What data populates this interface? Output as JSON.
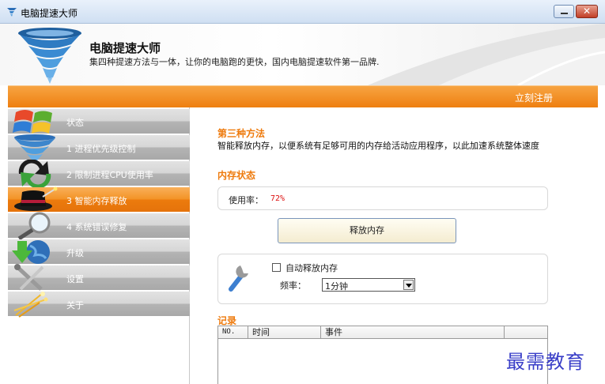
{
  "window": {
    "title": "电脑提速大师",
    "minimize_icon": "minimize-icon",
    "close_glyph": "✕"
  },
  "banner": {
    "title": "电脑提速大师",
    "subtitle": "集四种提速方法与一体，让你的电脑跑的更快，国内电脑提速软件第一品牌."
  },
  "toolbar": {
    "register_label": "立刻注册"
  },
  "sidebar": {
    "items": [
      {
        "label": "状态",
        "icon": "windows-logo-icon",
        "active": false
      },
      {
        "label": "1 进程优先级控制",
        "icon": "tornado-icon",
        "active": false
      },
      {
        "label": "2 限制进程CPU使用率",
        "icon": "refresh-arrows-icon",
        "active": false
      },
      {
        "label": "3 智能内存释放",
        "icon": "magic-hat-icon",
        "active": true
      },
      {
        "label": "4 系统错误修复",
        "icon": "magnifier-icon",
        "active": false
      },
      {
        "label": "升级",
        "icon": "download-globe-icon",
        "active": false
      },
      {
        "label": "设置",
        "icon": "tools-icon",
        "active": false
      },
      {
        "label": "关于",
        "icon": "sparkle-icon",
        "active": false
      }
    ]
  },
  "main": {
    "method_title": "第三种方法",
    "method_desc": "智能释放内存，以便系统有足够可用的内存给活动应用程序，以此加速系统整体速度",
    "memory_status_title": "内存状态",
    "usage_label": "使用率：",
    "usage_value": "72%",
    "release_button": "释放内存",
    "auto_release_label": "自动释放内存",
    "auto_release_checked": false,
    "frequency_label": "频率：",
    "frequency_value": "1分钟",
    "log_title": "记录",
    "log_columns": [
      "NO.",
      "时间",
      "事件",
      ""
    ]
  },
  "watermark": "最需教育",
  "colors": {
    "accent_orange": "#ee7f10",
    "usage_red": "#dd1111",
    "watermark_blue": "#3a3fc8"
  }
}
